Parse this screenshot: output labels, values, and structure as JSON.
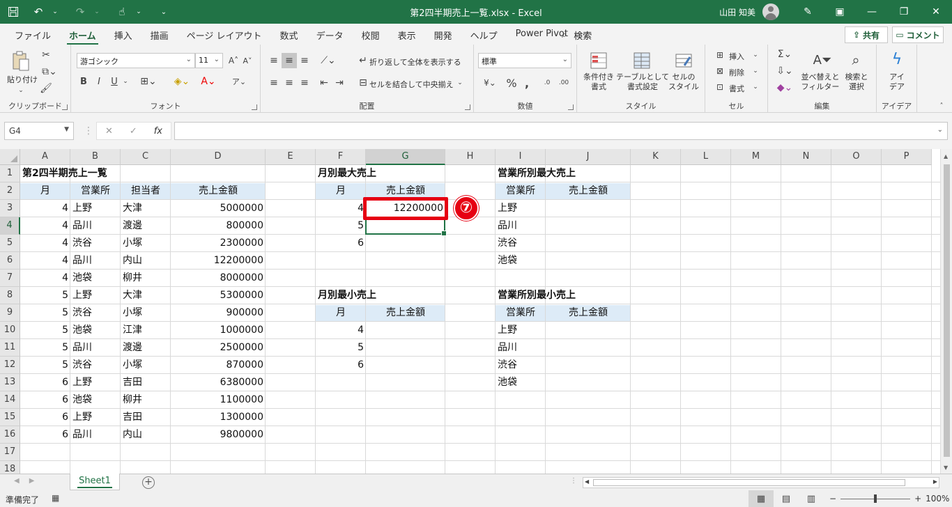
{
  "titlebar": {
    "title": "第2四半期売上一覧.xlsx  -  Excel",
    "user": "山田 知美"
  },
  "menu": {
    "tabs": [
      "ファイル",
      "ホーム",
      "挿入",
      "描画",
      "ページ レイアウト",
      "数式",
      "データ",
      "校閲",
      "表示",
      "開発",
      "ヘルプ",
      "Power Pivot"
    ],
    "active_tab": "ホーム",
    "search": "検索",
    "share": "共有",
    "comment": "コメント"
  },
  "ribbon": {
    "clipboard": {
      "label": "クリップボード",
      "paste": "貼り付け"
    },
    "font": {
      "label": "フォント",
      "font_name": "游ゴシック",
      "font_size": "11",
      "bold": "B",
      "italic": "I",
      "underline": "U"
    },
    "alignment": {
      "label": "配置",
      "wrap": "折り返して全体を表示する",
      "merge": "セルを結合して中央揃え"
    },
    "number": {
      "label": "数値",
      "format": "標準"
    },
    "styles": {
      "label": "スタイル",
      "conditional": "条件付き\n書式",
      "table": "テーブルとして\n書式設定",
      "cell_styles": "セルの\nスタイル"
    },
    "cells": {
      "label": "セル",
      "insert": "挿入",
      "delete": "削除",
      "format": "書式"
    },
    "editing": {
      "label": "編集",
      "sort": "並べ替えと\nフィルター",
      "find": "検索と\n選択"
    },
    "ideas": {
      "label": "アイデア",
      "ideas": "アイ\nデア"
    }
  },
  "formula_bar": {
    "name_box": "G4",
    "formula": ""
  },
  "columns": [
    "A",
    "B",
    "C",
    "D",
    "E",
    "F",
    "G",
    "H",
    "I",
    "J",
    "K",
    "L",
    "M",
    "N",
    "O",
    "P"
  ],
  "selected_column": "G",
  "selected_row": 4,
  "rows": [
    "1",
    "2",
    "3",
    "4",
    "5",
    "6",
    "7",
    "8",
    "9",
    "10",
    "11",
    "12",
    "13",
    "14",
    "15",
    "16",
    "17",
    "18"
  ],
  "sheet": {
    "main_title": "第2四半期売上一覧",
    "main_headers": [
      "月",
      "営業所",
      "担当者",
      "売上金額"
    ],
    "main_rows": [
      [
        "4",
        "上野",
        "大津",
        "5000000"
      ],
      [
        "4",
        "品川",
        "渡邊",
        "800000"
      ],
      [
        "4",
        "渋谷",
        "小塚",
        "2300000"
      ],
      [
        "4",
        "品川",
        "内山",
        "12200000"
      ],
      [
        "4",
        "池袋",
        "柳井",
        "8000000"
      ],
      [
        "5",
        "上野",
        "大津",
        "5300000"
      ],
      [
        "5",
        "渋谷",
        "小塚",
        "900000"
      ],
      [
        "5",
        "池袋",
        "江津",
        "1000000"
      ],
      [
        "5",
        "品川",
        "渡邊",
        "2500000"
      ],
      [
        "5",
        "渋谷",
        "小塚",
        "870000"
      ],
      [
        "6",
        "上野",
        "吉田",
        "6380000"
      ],
      [
        "6",
        "池袋",
        "柳井",
        "1100000"
      ],
      [
        "6",
        "上野",
        "吉田",
        "1300000"
      ],
      [
        "6",
        "品川",
        "内山",
        "9800000"
      ]
    ],
    "max_month": {
      "title": "月別最大売上",
      "headers": [
        "月",
        "売上金額"
      ],
      "rows": [
        [
          "4",
          "12200000"
        ],
        [
          "5",
          ""
        ],
        [
          "6",
          ""
        ]
      ]
    },
    "max_office": {
      "title": "営業所別最大売上",
      "headers": [
        "営業所",
        "売上金額"
      ],
      "rows": [
        [
          "上野",
          ""
        ],
        [
          "品川",
          ""
        ],
        [
          "渋谷",
          ""
        ],
        [
          "池袋",
          ""
        ]
      ]
    },
    "min_month": {
      "title": "月別最小売上",
      "headers": [
        "月",
        "売上金額"
      ],
      "rows": [
        [
          "4",
          ""
        ],
        [
          "5",
          ""
        ],
        [
          "6",
          ""
        ]
      ]
    },
    "min_office": {
      "title": "営業所別最小売上",
      "headers": [
        "営業所",
        "売上金額"
      ],
      "rows": [
        [
          "上野",
          ""
        ],
        [
          "品川",
          ""
        ],
        [
          "渋谷",
          ""
        ],
        [
          "池袋",
          ""
        ]
      ]
    }
  },
  "annotation": {
    "badge": "⑦"
  },
  "sheet_tabs": {
    "active": "Sheet1"
  },
  "status": {
    "ready": "準備完了",
    "zoom": "100%"
  }
}
